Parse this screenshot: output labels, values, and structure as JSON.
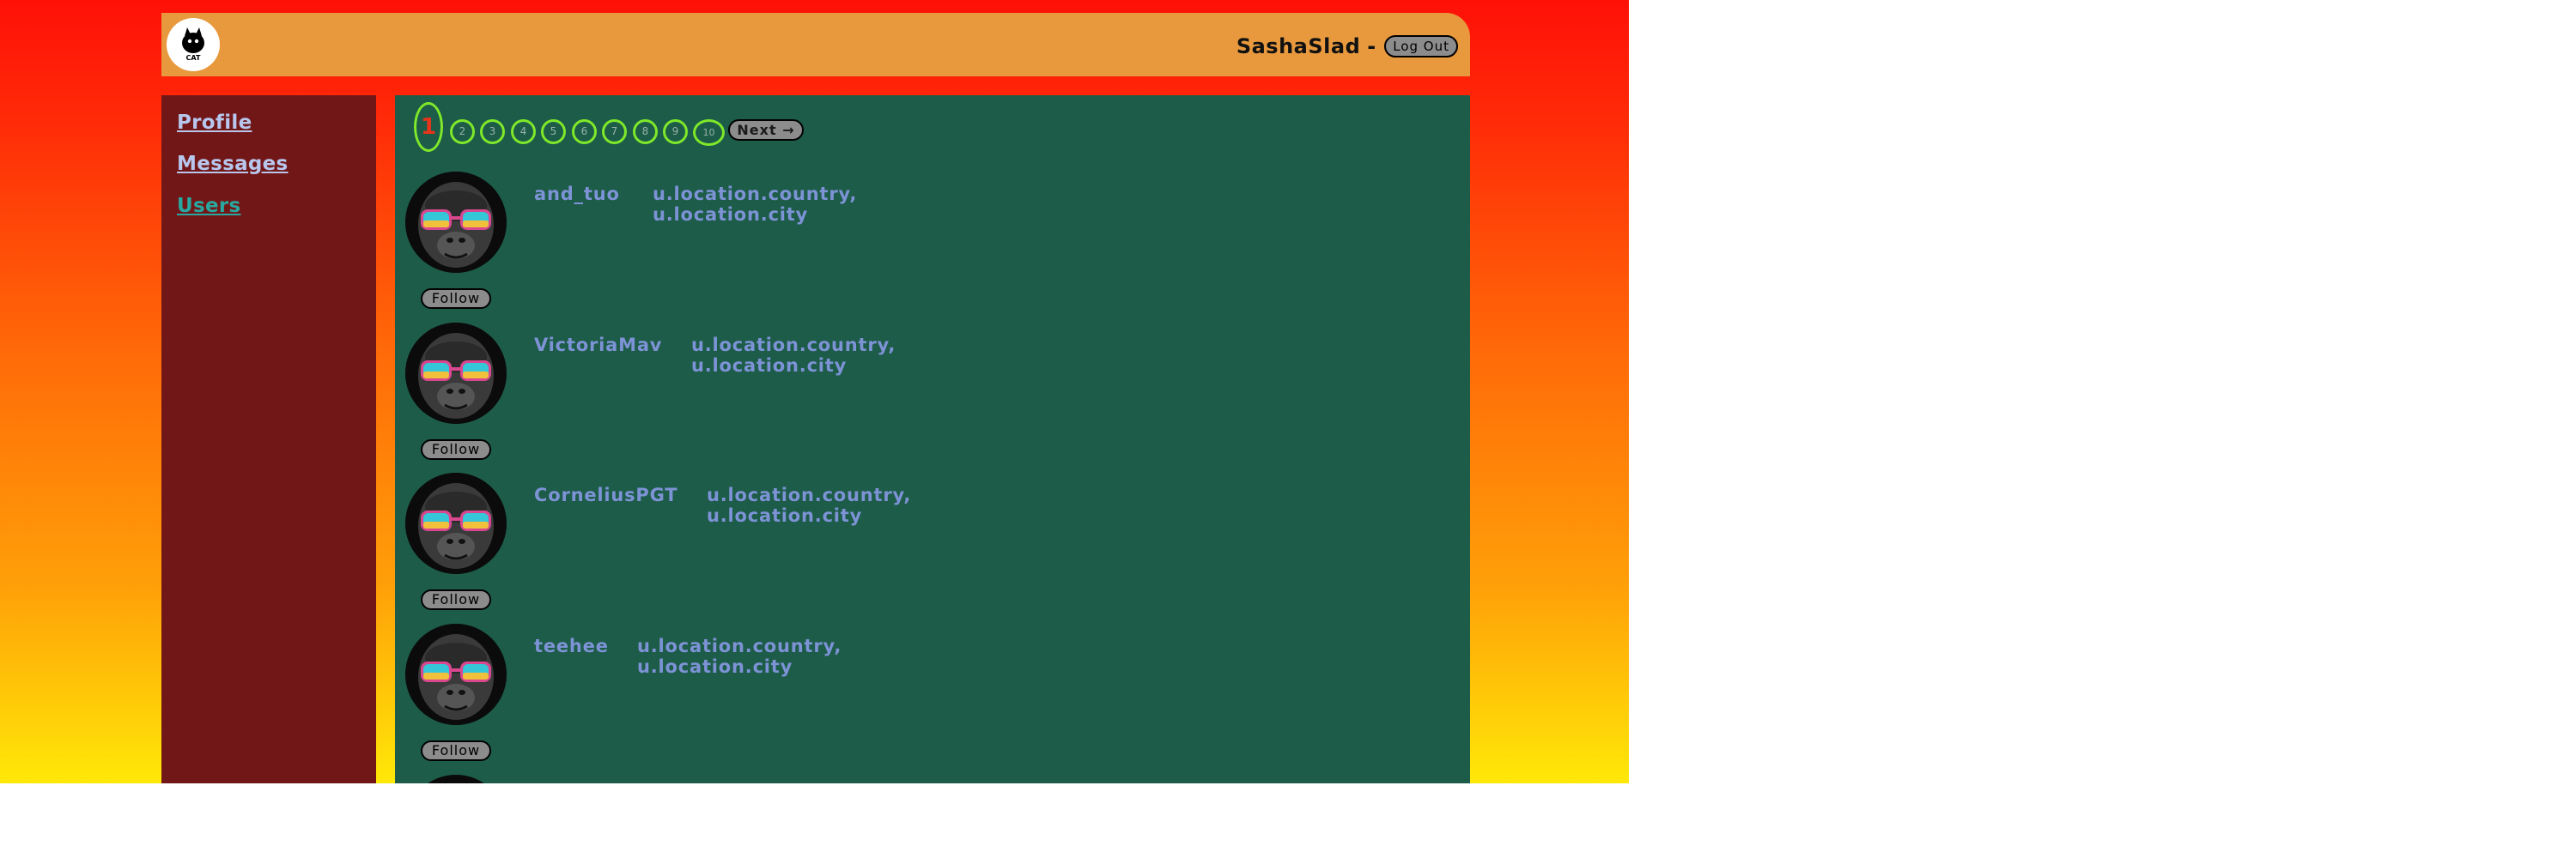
{
  "header": {
    "logo_text": "CAT",
    "username": "SashaSlad",
    "separator": "-",
    "logout_label": "Log Out"
  },
  "sidebar": {
    "items": [
      {
        "label": "Profile"
      },
      {
        "label": "Messages"
      },
      {
        "label": "Users"
      }
    ],
    "active": "Users"
  },
  "pagination": {
    "pages": [
      "1",
      "2",
      "3",
      "4",
      "5",
      "6",
      "7",
      "8",
      "9",
      "10"
    ],
    "current": "1",
    "next_label": "Next →"
  },
  "users": [
    {
      "name": "and_tuo",
      "country": "u.location.country,",
      "city": "u.location.city",
      "follow_label": "Follow"
    },
    {
      "name": "VictoriaMav",
      "country": "u.location.country,",
      "city": "u.location.city",
      "follow_label": "Follow"
    },
    {
      "name": "CorneliusPGT",
      "country": "u.location.country,",
      "city": "u.location.city",
      "follow_label": "Follow"
    },
    {
      "name": "teehee",
      "country": "u.location.country,",
      "city": "u.location.city",
      "follow_label": "Follow"
    }
  ],
  "icons": {
    "logo": "cat-logo-icon",
    "avatar": "gorilla-sunglasses-avatar"
  },
  "colors": {
    "header_bg": "#e8993d",
    "sidebar_bg": "#721717",
    "content_bg": "#1c5c48",
    "link_inactive": "#b7c7ee",
    "link_active": "#27a8a0",
    "user_text": "#7d93d6",
    "pager_ring": "#7fe82a",
    "pager_current": "#e6351a"
  }
}
